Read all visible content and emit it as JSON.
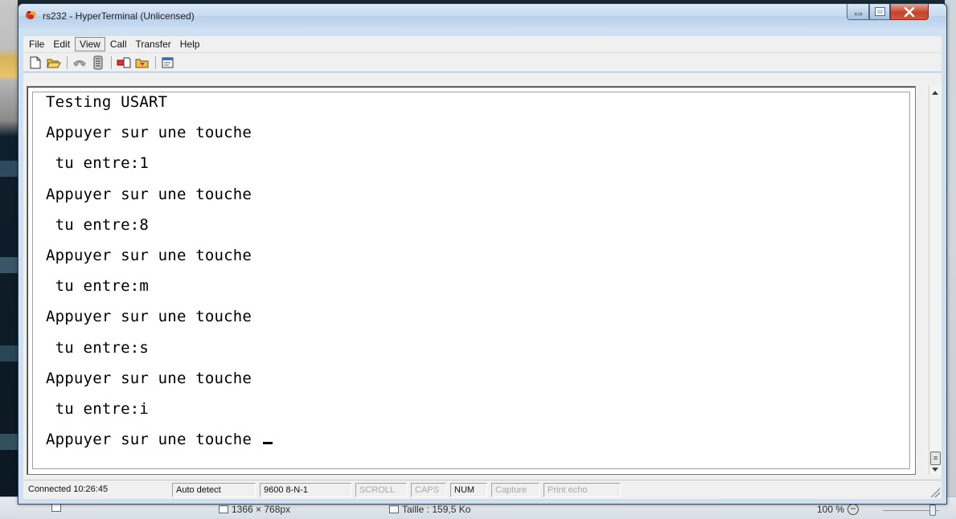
{
  "window": {
    "title": "rs232 - HyperTerminal (Unlicensed)",
    "controls": {
      "minimize_icon": "minimize-icon",
      "maximize_icon": "maximize-icon",
      "close_icon": "close-icon"
    },
    "close_color": "#c5432b"
  },
  "menu": {
    "items": [
      "File",
      "Edit",
      "View",
      "Call",
      "Transfer",
      "Help"
    ],
    "active": "View"
  },
  "toolbar": {
    "buttons": [
      "new-document-icon",
      "open-folder-icon",
      "disconnect-phone-icon",
      "dial-phone-icon",
      "send-file-icon",
      "receive-file-icon",
      "properties-icon"
    ]
  },
  "terminal": {
    "lines": [
      "Testing USART",
      "Appuyer sur une touche",
      " tu entre:1",
      "Appuyer sur une touche",
      " tu entre:8",
      "Appuyer sur une touche",
      " tu entre:m",
      "Appuyer sur une touche",
      " tu entre:s",
      "Appuyer sur une touche",
      " tu entre:i",
      "Appuyer sur une touche "
    ]
  },
  "statusbar": {
    "connected": "Connected 10:26:45",
    "detect": "Auto detect",
    "settings": "9600 8-N-1",
    "scroll": "SCROLL",
    "caps": "CAPS",
    "num": "NUM",
    "capture": "Capture",
    "print_echo": "Print echo"
  },
  "background_viewer": {
    "dimensions": "1366 × 768px",
    "size": "Taille : 159,5 Ko",
    "zoom": "100 %"
  }
}
